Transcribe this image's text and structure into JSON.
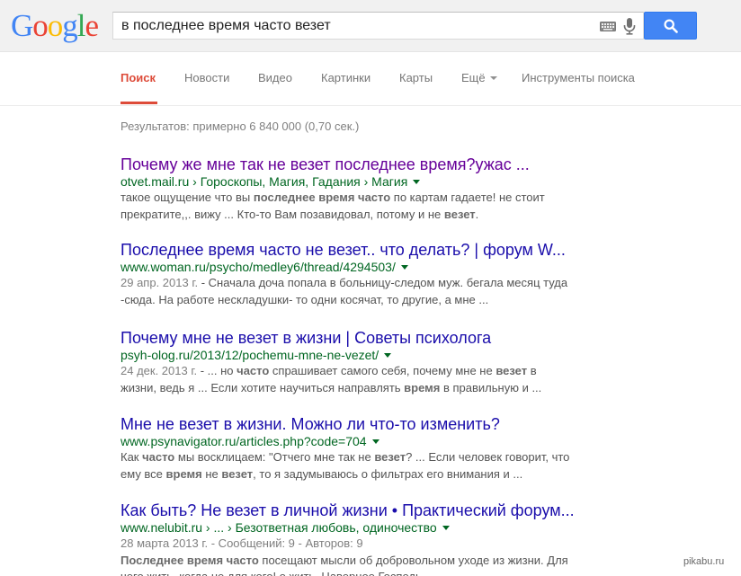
{
  "logo": {
    "letters": [
      "G",
      "o",
      "o",
      "g",
      "l",
      "e"
    ],
    "colors": [
      "#4285f4",
      "#ea4335",
      "#fbbc05",
      "#4285f4",
      "#34a853",
      "#ea4335"
    ]
  },
  "search": {
    "query": "в последнее время часто везет",
    "button_icon": "search-icon"
  },
  "tabs": {
    "search": "Поиск",
    "news": "Новости",
    "video": "Видео",
    "images": "Картинки",
    "maps": "Карты",
    "more": "Ещё",
    "tools": "Инструменты поиска"
  },
  "stats": "Результатов: примерно 6 840 000 (0,70 сек.)",
  "results": [
    {
      "title": "Почему же мне так не везет последнее время?ужас ...",
      "url": "otvet.mail.ru › Гороскопы, Магия, Гадания › Магия",
      "l1a": "такое ощущение что вы ",
      "l1b": "последнее время часто",
      "l1c": " по картам гадаете! не стоит",
      "l2a": "прекратите,,. вижу ... Кто-то Вам позавидовал, потому и не ",
      "l2b": "везет",
      "l2c": "."
    },
    {
      "title": "Последнее время часто не везет.. что делать? | форум W...",
      "url": "www.woman.ru/psycho/medley6/thread/4294503/",
      "date": "29 апр. 2013 г.",
      "l1": " - Сначала доча попала в больницу-следом муж. бегала месяц туда",
      "l2": "-сюда. На работе нескладушки- то одни косячат, то другие, а мне ..."
    },
    {
      "title": "Почему мне не везет в жизни | Советы психолога",
      "url": "psyh-olog.ru/2013/12/pochemu-mne-ne-vezet/",
      "date": "24 дек. 2013 г.",
      "l1a": " - ... но ",
      "l1b": "часто",
      "l1c": " спрашивает самого себя, почему мне не ",
      "l1d": "везет",
      "l1e": " в",
      "l2a": "жизни, ведь я ... Если хотите научиться направлять ",
      "l2b": "время",
      "l2c": " в правильную и ..."
    },
    {
      "title": "Мне не везет в жизни. Можно ли что-то изменить?",
      "url": "www.psynavigator.ru/articles.php?code=704",
      "l1a": "Как ",
      "l1b": "часто",
      "l1c": " мы восклицаем: \"Отчего мне так не ",
      "l1d": "везет",
      "l1e": "? ... Если человек говорит, что",
      "l2a": "ему все ",
      "l2b": "время",
      "l2c": " не ",
      "l2d": "везет",
      "l2e": ", то я задумываюсь о фильтрах его внимания и ..."
    },
    {
      "title": "Как быть? Не везет в личной жизни • Практический форум...",
      "url": "www.nelubit.ru › ... › Безответная любовь, одиночество",
      "date_line": "28 марта 2013 г. - Сообщений: 9 - Авторов: 9",
      "l1b": "Последнее время часто",
      "l1c": " посещают мысли об добровольном уходе из жизни. Для",
      "l2": "чего жить, когда не для кого! о жить. Наверное Господь"
    }
  ],
  "watermark": "pikabu.ru"
}
